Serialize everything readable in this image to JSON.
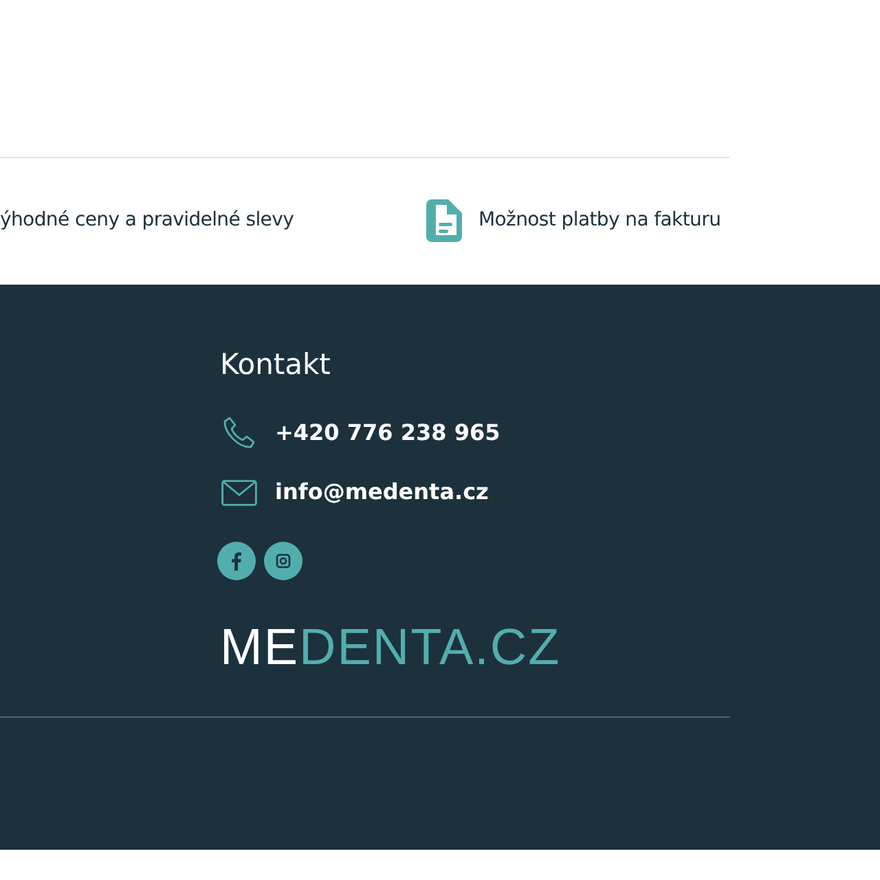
{
  "features": [
    {
      "kind": "plain",
      "text": "ýhodné ceny a pravidelné slevy"
    },
    {
      "kind": "document",
      "text": "Možnost platby na fakturu"
    }
  ],
  "footer": {
    "heading": "Kontakt",
    "contacts": [
      {
        "kind": "phone",
        "text": "+420 776 238 965"
      },
      {
        "kind": "email",
        "text": "info@medenta.cz"
      }
    ],
    "social": [
      {
        "kind": "facebook"
      },
      {
        "kind": "instagram"
      }
    ],
    "logo": {
      "part_1": "ME",
      "part_2": "DENTA.CZ"
    }
  }
}
